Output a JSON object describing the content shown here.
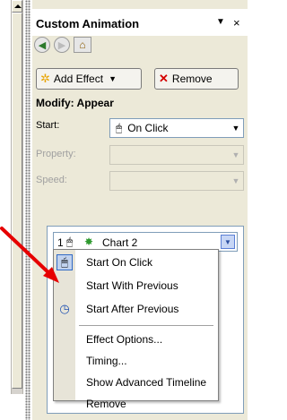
{
  "pane": {
    "title": "Custom Animation",
    "dropdown_glyph": "▼",
    "close_glyph": "×"
  },
  "nav": {
    "back_glyph": "◀",
    "forward_glyph": "▶",
    "home_glyph": "⌂"
  },
  "toolbar": {
    "add_effect_label": "Add Effect",
    "add_effect_arrow": "▼",
    "remove_label": "Remove"
  },
  "modify": {
    "heading": "Modify: Appear",
    "start_label": "Start:",
    "start_value": "On Click",
    "property_label": "Property:",
    "speed_label": "Speed:"
  },
  "list": {
    "item_number": "1",
    "item_name": "Chart 2"
  },
  "menu": {
    "start_on_click": "Start On Click",
    "start_with_previous": "Start With Previous",
    "start_after_previous": "Start After Previous",
    "effect_options": "Effect Options...",
    "timing": "Timing...",
    "show_advanced_timeline": "Show Advanced Timeline",
    "remove": "Remove"
  },
  "icons": {
    "add_effect": "star-icon",
    "remove": "remove-x-icon",
    "mouse": "mouse-icon",
    "clock": "clock-icon",
    "effect": "green-star-icon"
  },
  "colors": {
    "pane_bg": "#ece9d8",
    "annotation_arrow": "#e60000",
    "selection_border": "#316ac5",
    "field_border": "#7f9db9"
  }
}
